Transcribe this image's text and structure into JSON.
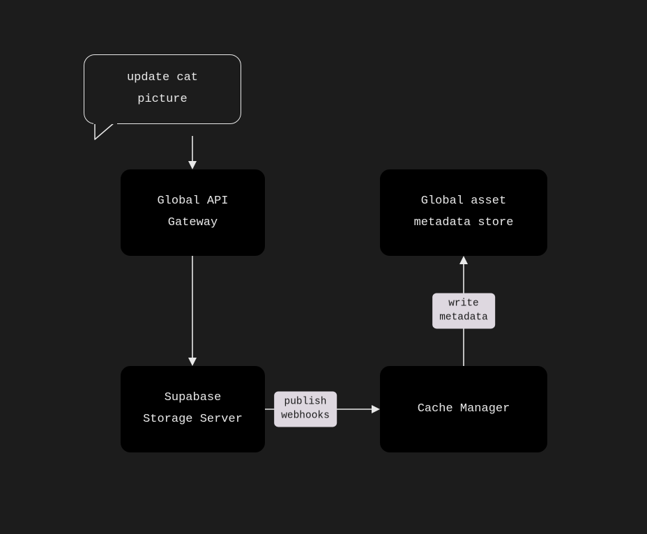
{
  "diagram": {
    "input_bubble": {
      "line1": "update cat",
      "line2": "picture"
    },
    "nodes": {
      "api_gateway": {
        "line1": "Global API",
        "line2": "Gateway"
      },
      "storage_server": {
        "line1": "Supabase",
        "line2": "Storage Server"
      },
      "cache_manager": {
        "line1": "Cache Manager"
      },
      "metadata_store": {
        "line1": "Global asset",
        "line2": "metadata store"
      }
    },
    "edges": {
      "publish_webhooks": {
        "line1": "publish",
        "line2": "webhooks"
      },
      "write_metadata": {
        "line1": "write",
        "line2": "metadata"
      }
    }
  }
}
